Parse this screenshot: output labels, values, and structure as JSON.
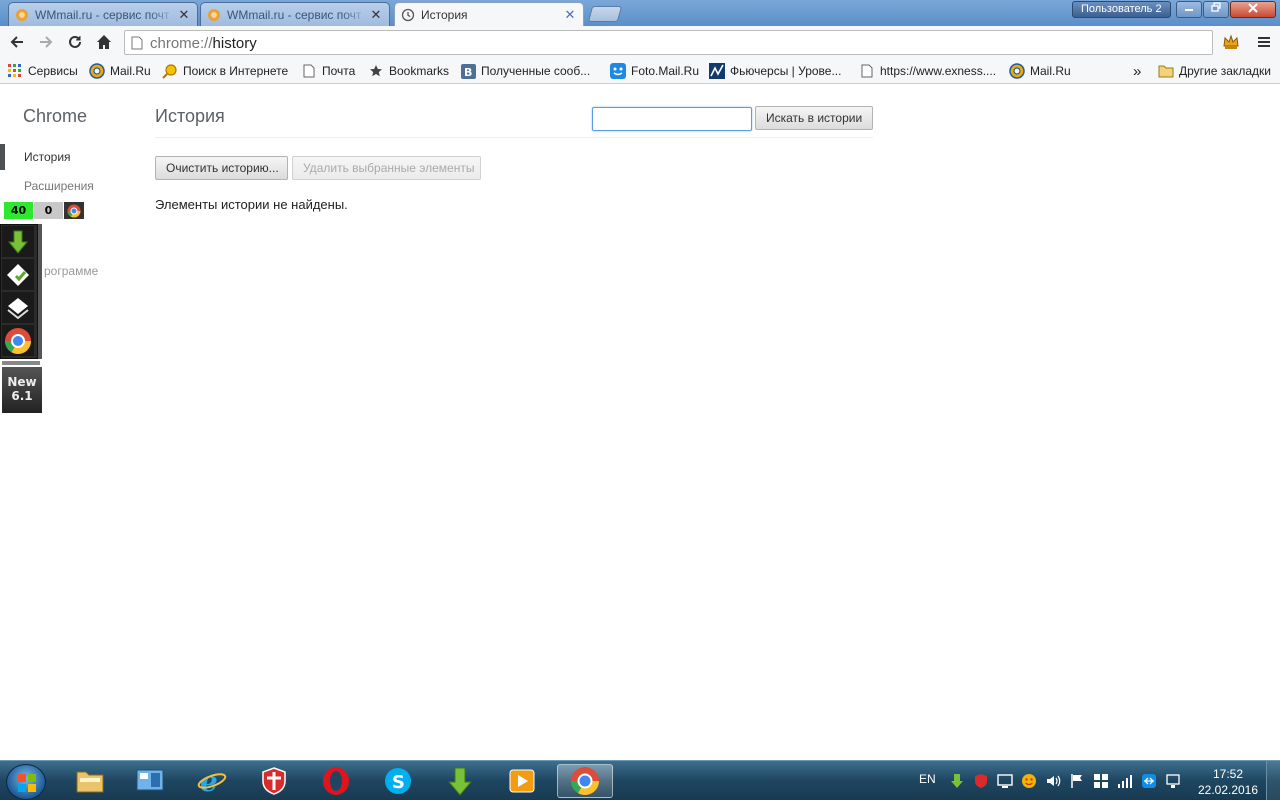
{
  "tabs": [
    {
      "title": "WMmail.ru - сервис почт",
      "active": false,
      "close": "✕"
    },
    {
      "title": "WMmail.ru - сервис почт",
      "active": false,
      "close": "✕"
    },
    {
      "title": "История",
      "active": true,
      "close": "✕"
    }
  ],
  "window": {
    "user_label": "Пользователь 2"
  },
  "omnibox": {
    "scheme": "chrome://",
    "path": "history"
  },
  "bookmarks": [
    {
      "label": "Сервисы",
      "icon": "apps-grid-icon"
    },
    {
      "label": "Mail.Ru",
      "icon": "mailru-at-icon"
    },
    {
      "label": "Поиск в Интернете",
      "icon": "search-mailru-icon"
    },
    {
      "label": "Почта",
      "icon": "page-icon"
    },
    {
      "label": "Bookmarks",
      "icon": "star-icon"
    },
    {
      "label": "Полученные сооб...",
      "icon": "vk-icon"
    },
    {
      "label": "Foto.Mail.Ru",
      "icon": "foto-icon"
    },
    {
      "label": "Фьючерсы | Урове...",
      "icon": "chart-site-icon"
    },
    {
      "label": "https://www.exness....",
      "icon": "page-icon"
    },
    {
      "label": "Mail.Ru",
      "icon": "mailru-at-icon"
    }
  ],
  "bookmarks_overflow": "»",
  "other_bookmarks": "Другие закладки",
  "sidebar": {
    "brand": "Chrome",
    "items": [
      {
        "label": "История"
      },
      {
        "label": "Расширения"
      },
      {
        "label": "рограмме"
      }
    ]
  },
  "page": {
    "title": "История",
    "search_button": "Искать в истории",
    "clear_button": "Очистить историю...",
    "delete_button": "Удалить выбранные элементы",
    "empty_message": "Элементы истории не найдены."
  },
  "widget": {
    "count_green": "40",
    "count_grey": "0",
    "new_line1": "New",
    "new_line2": "6.1"
  },
  "taskbar": {
    "lang": "EN",
    "time": "17:52",
    "date": "22.02.2016"
  },
  "colors": {
    "titlebar": "#5b8fc9",
    "focus_blue": "#5a9de6",
    "counter_green": "#2ee82e"
  }
}
